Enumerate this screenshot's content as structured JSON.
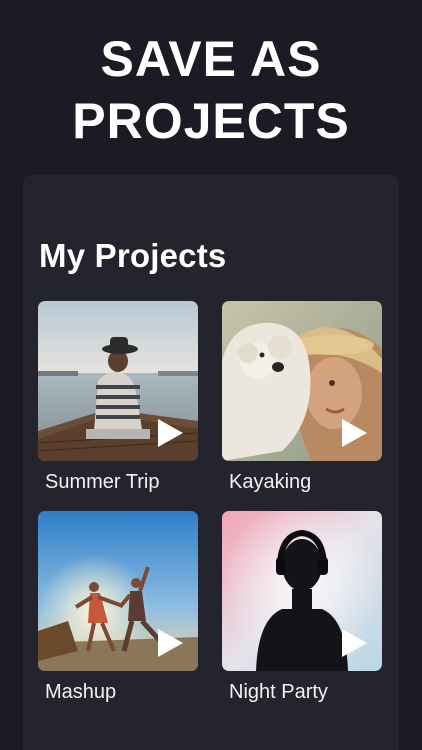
{
  "headline": {
    "line1": "SAVE AS",
    "line2": "PROJECTS"
  },
  "panel": {
    "title": "My Projects"
  },
  "projects": [
    {
      "label": "Summer Trip"
    },
    {
      "label": "Kayaking"
    },
    {
      "label": "Mashup"
    },
    {
      "label": "Night Party"
    }
  ],
  "colors": {
    "background": "#1a1b24",
    "panel": "#23242d",
    "text": "#ffffff"
  },
  "icons": {
    "play": "play-icon"
  }
}
